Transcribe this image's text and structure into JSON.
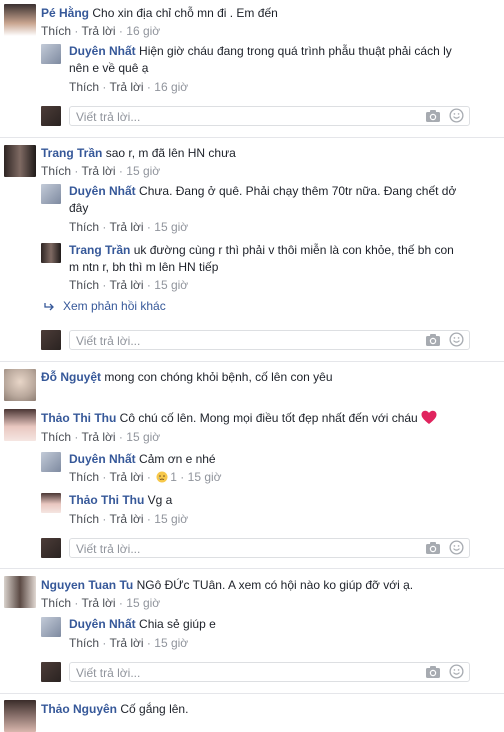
{
  "common": {
    "like": "Thích",
    "reply": "Trả lời",
    "reply_placeholder": "Viết trả lời...",
    "view_more": "Xem phản hồi khác"
  },
  "c1": {
    "name": "Pé Hằng",
    "text": "Cho xin địa chỉ chỗ mn đi . Em đến",
    "time": "16 giờ",
    "r1": {
      "name": "Duyên Nhất",
      "text1": "Hiện giờ cháu đang trong quá trình phẫu thuật phải cách ly",
      "text2": "nên e về quê ạ",
      "time": "16 giờ"
    }
  },
  "c2": {
    "name": "Trang Trần",
    "text": "sao r, m đã lên HN chưa",
    "time": "15 giờ",
    "r1": {
      "name": "Duyên Nhất",
      "text1": "Chưa. Đang ở quê. Phải chạy thêm 70tr nữa. Đang chết dở",
      "text2": "đây",
      "time": "15 giờ"
    },
    "r2": {
      "name": "Trang Trần",
      "text1": "uk đường cùng r thì phải v thôi miễn là con khỏe, thế bh con",
      "text2": "m ntn r, bh thì m lên HN tiếp",
      "time": "15 giờ"
    }
  },
  "c3": {
    "name": "Đỗ Nguyệt",
    "text": "mong con chóng khỏi bệnh, cố lên con yêu"
  },
  "c4": {
    "name": "Thảo Thi Thu",
    "text": "Cô chú cố lên. Mong mọi điều tốt đẹp nhất đến với cháu",
    "time": "15 giờ",
    "r1": {
      "name": "Duyên Nhất",
      "text": "Cảm ơn e nhé",
      "reaction_count": "1",
      "time": "15 giờ"
    },
    "r2": {
      "name": "Thảo Thi Thu",
      "text": "Vg a",
      "time": "15 giờ"
    }
  },
  "c5": {
    "name": "Nguyen Tuan Tu",
    "text": "NGô ĐỨc TUân. A xem có hội nào ko giúp đỡ với ạ.",
    "time": "15 giờ",
    "r1": {
      "name": "Duyên Nhất",
      "text": "Chia sẻ giúp e",
      "time": "15 giờ"
    }
  },
  "c6": {
    "name": "Thảo Nguyên",
    "text": "Cố gắng lên."
  },
  "colors": {
    "name": "#365899",
    "meta": "#90949c",
    "heart": "#e0245e",
    "separator": "#e5e6ea"
  },
  "icons": [
    "camera-icon",
    "smiley-icon",
    "heart-icon",
    "crying-emoji-icon",
    "reply-arrow-icon"
  ]
}
